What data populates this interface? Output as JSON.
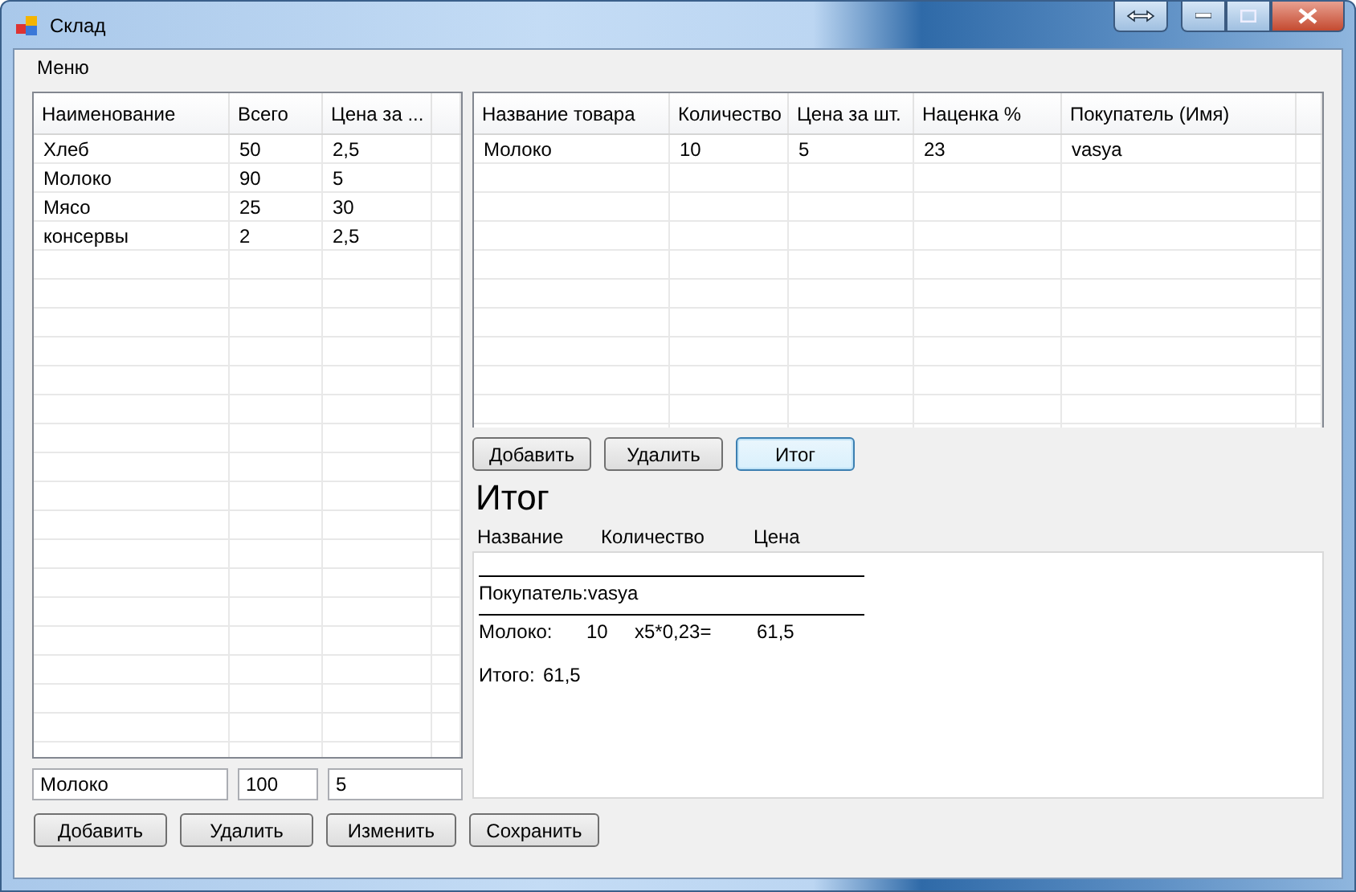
{
  "window": {
    "title": "Склад"
  },
  "menu": [
    "Меню"
  ],
  "stock_table": {
    "columns": [
      "Наименование",
      "Всего",
      "Цена за ..."
    ],
    "rows": [
      [
        "Хлеб",
        "50",
        "2,5"
      ],
      [
        "Молоко",
        "90",
        "5"
      ],
      [
        "Мясо",
        "25",
        "30"
      ],
      [
        "консервы",
        "2",
        "2,5"
      ]
    ]
  },
  "stock_fields": [
    "Молоко",
    "100",
    "5"
  ],
  "stock_buttons": [
    {
      "label": "Добавить",
      "focused": false
    },
    {
      "label": "Удалить",
      "focused": false
    },
    {
      "label": "Изменить",
      "focused": false
    },
    {
      "label": "Сохранить",
      "focused": false
    }
  ],
  "sales_table": {
    "columns": [
      "Название товара",
      "Количество",
      "Цена за шт.",
      "Наценка %",
      "Покупатель (Имя)"
    ],
    "rows": [
      [
        "Молоко",
        "10",
        "5",
        "23",
        "vasya"
      ]
    ]
  },
  "sales_buttons": [
    {
      "label": "Добавить",
      "focused": false
    },
    {
      "label": "Удалить",
      "focused": false
    },
    {
      "label": "Итог",
      "focused": true
    }
  ],
  "summary": {
    "title": "Итог",
    "columns": [
      "Название",
      "Количество",
      "Цена"
    ],
    "buyer_line": "Покупатель:vasya",
    "item_line": [
      "Молоко:",
      "10",
      "x5*0,23=",
      "61,5"
    ],
    "total_label": "Итого:",
    "total_value": "61,5"
  }
}
